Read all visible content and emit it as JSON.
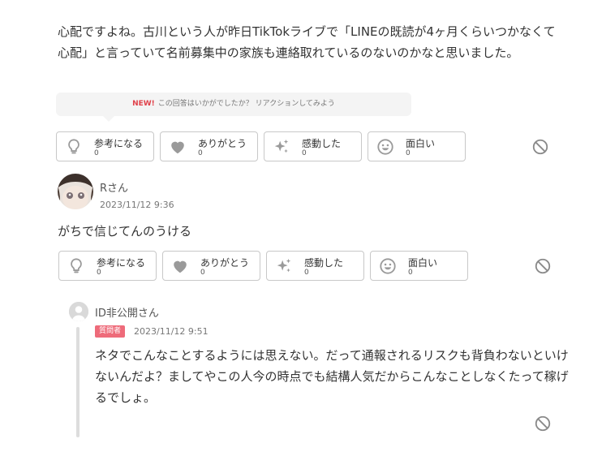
{
  "answer": {
    "text": "心配ですよね。古川という人が昨日TikTokライブで「LINEの既読が4ヶ月くらいつかなくて心配」と言っていて名前募集中の家族も連絡取れているのないのかなと思いました。"
  },
  "reaction_prompt": {
    "new_label": "NEW!",
    "text": "この回答はいかがでしたか？ リアクションしてみよう"
  },
  "answer_reactions": [
    {
      "label": "参考になる",
      "count": "0",
      "icon": "lightbulb-icon"
    },
    {
      "label": "ありがとう",
      "count": "0",
      "icon": "heart-icon"
    },
    {
      "label": "感動した",
      "count": "0",
      "icon": "sparkle-icon"
    },
    {
      "label": "面白い",
      "count": "0",
      "icon": "smile-icon"
    }
  ],
  "comment": {
    "user_name": "Rさん",
    "date": "2023/11/12 9:36",
    "text": "がちで信じてんのうける"
  },
  "comment_reactions": [
    {
      "label": "参考になる",
      "count": "0",
      "icon": "lightbulb-icon"
    },
    {
      "label": "ありがとう",
      "count": "0",
      "icon": "heart-icon"
    },
    {
      "label": "感動した",
      "count": "0",
      "icon": "sparkle-icon"
    },
    {
      "label": "面白い",
      "count": "0",
      "icon": "smile-icon"
    }
  ],
  "reply": {
    "user_name": "ID非公開",
    "user_suffix": "さん",
    "badge": "質問者",
    "date": "2023/11/12 9:51",
    "text": "ネタでこんなことするようには思えない。だって通報されるリスクも背負わないといけないんだよ？ましてやこの人今の時点でも結構人気だからこんなことしなくたって稼げるでしょ。"
  },
  "colors": {
    "accent_new": "#e0414a",
    "badge": "#ee6b7a",
    "icon_gray": "#9a9a9a",
    "border": "#c8c8c8"
  }
}
